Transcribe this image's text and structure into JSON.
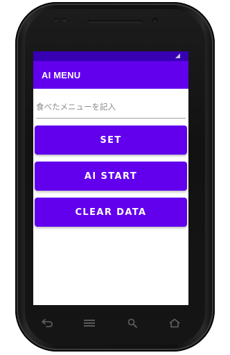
{
  "app": {
    "title": "AI MENU"
  },
  "form": {
    "menu_input": {
      "value": "",
      "placeholder": "食べたメニューを記入"
    }
  },
  "buttons": {
    "set_label": "SET",
    "ai_start_label": "AI START",
    "clear_data_label": "CLEAR DATA"
  },
  "colors": {
    "primary": "#6200ee",
    "status_bar": "#3700b3",
    "on_primary": "#ffffff"
  },
  "device": {
    "nav_icons": [
      "back-icon",
      "home-menu-icon",
      "search-icon",
      "home-icon"
    ],
    "status_icons": [
      "signal-icon"
    ]
  }
}
